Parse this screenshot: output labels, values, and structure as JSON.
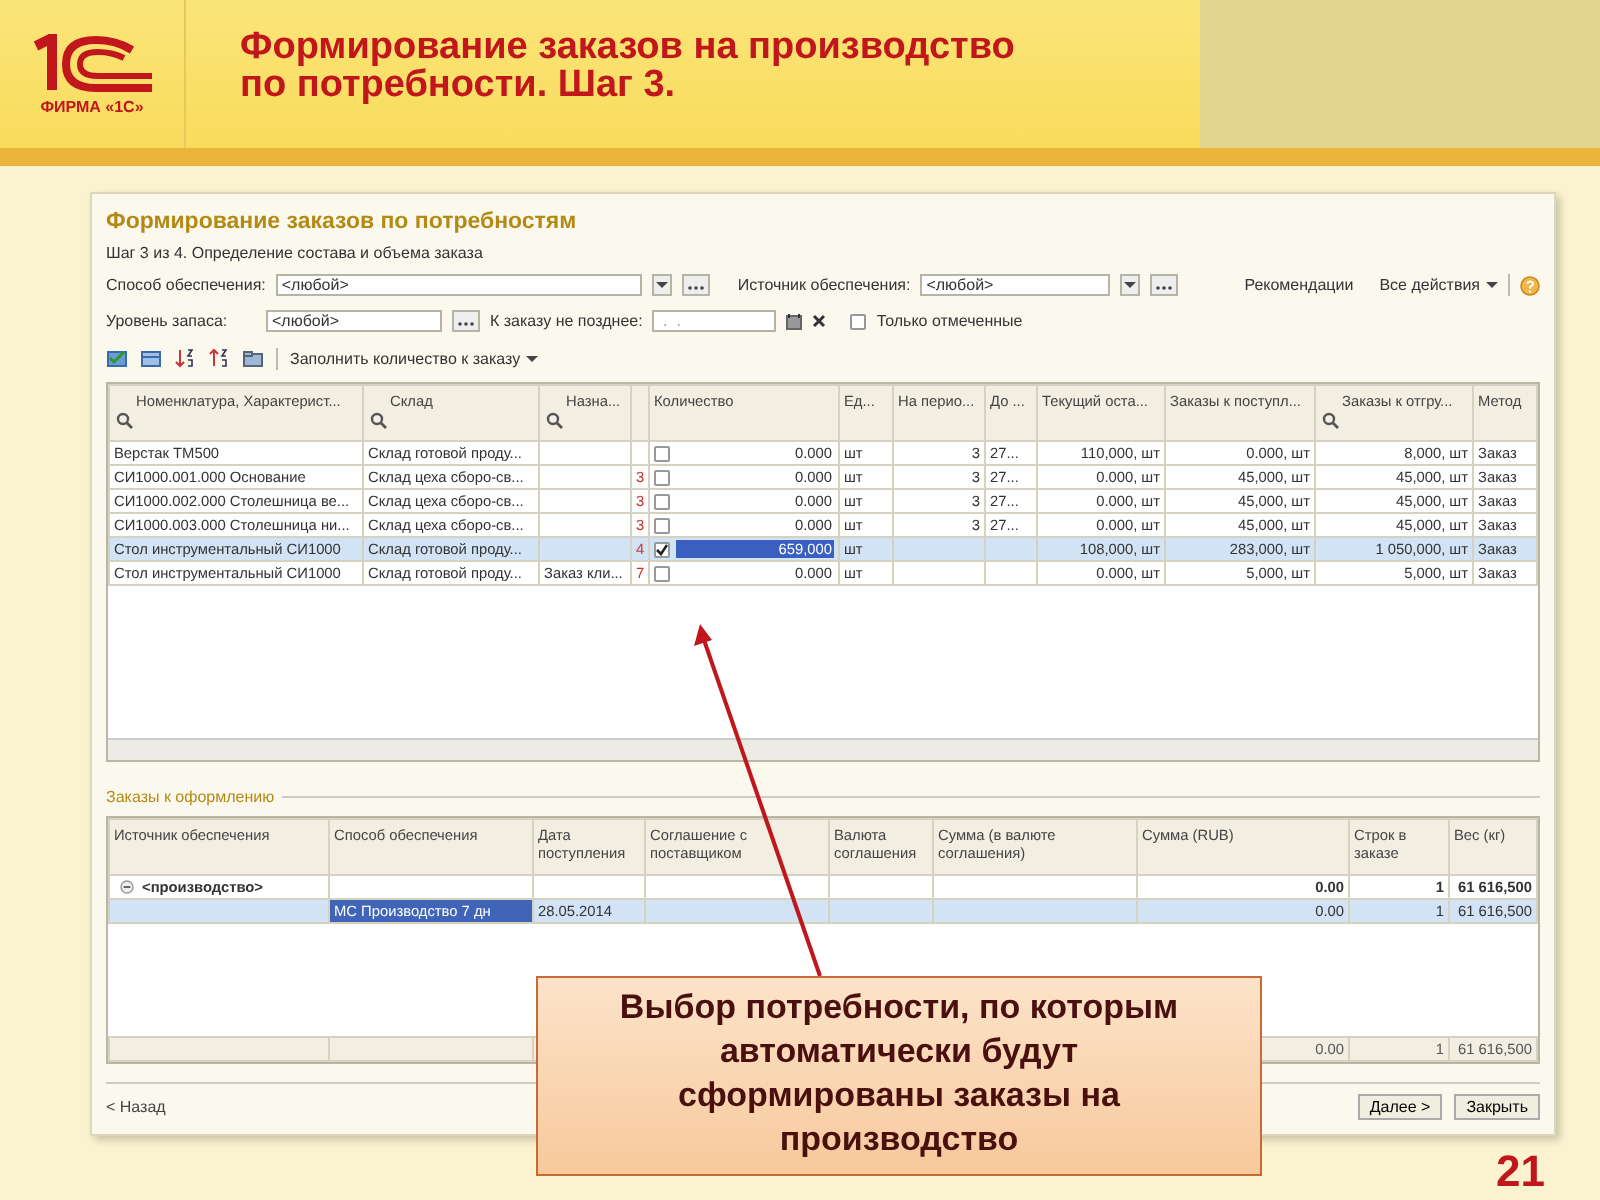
{
  "header": {
    "logo_caption": "ФИРМА «1С»",
    "title_lines": [
      "Формирование заказов на производство",
      "по потребности. Шаг 3."
    ]
  },
  "window": {
    "title": "Формирование заказов по потребностям",
    "step": "Шаг 3 из 4. Определение состава и объема заказа",
    "filters": [
      {
        "kind": "select",
        "label": "Способ обеспечения:",
        "value": "<любой>"
      },
      {
        "kind": "select",
        "label": "Источник обеспечения:",
        "value": "<любой>"
      },
      {
        "kind": "choice",
        "label": "Уровень запаса:",
        "value": "<любой>"
      },
      {
        "kind": "date",
        "label": "К заказу не позднее:",
        "placeholder": " .  ."
      },
      {
        "kind": "checkbox",
        "label": "Только отмеченные",
        "checked": false
      }
    ],
    "links": [
      "Рекомендации",
      "Все действия"
    ],
    "fill_button": "Заполнить количество к заказу"
  },
  "grid": {
    "columns": [
      {
        "label": "Номенклатура, Характерист...",
        "search": true
      },
      {
        "label": "Склад",
        "search": true
      },
      {
        "label": "Назна...",
        "search": true
      },
      {
        "search": false
      },
      {
        "label": "Количество",
        "search": false
      },
      {
        "label": "Ед...",
        "search": false
      },
      {
        "label": "На перио...",
        "search": false
      },
      {
        "label": "До ...",
        "search": false
      },
      {
        "label": "Текущий оста...",
        "search": false
      },
      {
        "label": "Заказы к поступл...",
        "search": false
      },
      {
        "label": "Заказы к отгру...",
        "search": true
      },
      {
        "label": "Метод",
        "search": false
      }
    ],
    "rows": [
      {
        "selected": false,
        "checked": false,
        "cells": [
          "Верстак ТМ500",
          "Склад готовой проду...",
          "",
          "",
          "0.000",
          "шт",
          "3",
          "27...",
          "110,000, шт",
          "0.000, шт",
          "8,000, шт",
          "Заказ"
        ]
      },
      {
        "selected": false,
        "checked": false,
        "cells": [
          "СИ1000.001.000 Основание",
          "Склад цеха сборо-св...",
          "",
          "3",
          "0.000",
          "шт",
          "3",
          "27...",
          "0.000, шт",
          "45,000, шт",
          "45,000, шт",
          "Заказ"
        ]
      },
      {
        "selected": false,
        "checked": false,
        "cells": [
          "СИ1000.002.000 Столешница ве...",
          "Склад цеха сборо-св...",
          "",
          "3",
          "0.000",
          "шт",
          "3",
          "27...",
          "0.000, шт",
          "45,000, шт",
          "45,000, шт",
          "Заказ"
        ]
      },
      {
        "selected": false,
        "checked": false,
        "cells": [
          "СИ1000.003.000 Столешница ни...",
          "Склад цеха сборо-св...",
          "",
          "3",
          "0.000",
          "шт",
          "3",
          "27...",
          "0.000, шт",
          "45,000, шт",
          "45,000, шт",
          "Заказ"
        ]
      },
      {
        "selected": true,
        "checked": true,
        "cells": [
          "Стол инструментальный СИ1000",
          "Склад готовой проду...",
          "",
          "4",
          "659,000",
          "шт",
          "",
          "",
          "108,000, шт",
          "283,000, шт",
          "1 050,000, шт",
          "Заказ"
        ]
      },
      {
        "selected": false,
        "checked": false,
        "cells": [
          "Стол инструментальный СИ1000",
          "Склад готовой проду...",
          "Заказ кли...",
          "7",
          "0.000",
          "шт",
          "",
          "",
          "0.000, шт",
          "5,000, шт",
          "5,000, шт",
          "Заказ"
        ]
      }
    ]
  },
  "orders": {
    "title": "Заказы к оформлению",
    "columns": [
      "Источник обеспечения",
      "Способ обеспечения",
      "Дата поступления",
      "Соглашение с поставщиком",
      "Валюта соглашения",
      "Сумма (в валюте соглашения)",
      "Сумма (RUB)",
      "Строк в заказе",
      "Вес (кг)"
    ],
    "rows": [
      {
        "kind": "group",
        "selected": false,
        "cells": [
          "<производство>",
          "",
          "",
          "",
          "",
          "",
          "0.00",
          "1",
          "61 616,500"
        ]
      },
      {
        "kind": "item",
        "selected": true,
        "cells": [
          "",
          "МС Производство 7 дн",
          "28.05.2014",
          "",
          "",
          "",
          "0.00",
          "1",
          "61 616,500"
        ]
      }
    ],
    "totals": {
      "sum_rub": "0.00",
      "lines": "1",
      "weight": "61 616,500"
    }
  },
  "footer": {
    "back": "< Назад",
    "buttons": [
      "Далее >",
      "Закрыть"
    ]
  },
  "callout": "Выбор потребности, по которым автоматически будут сформированы заказы на производство",
  "page_number": "21"
}
